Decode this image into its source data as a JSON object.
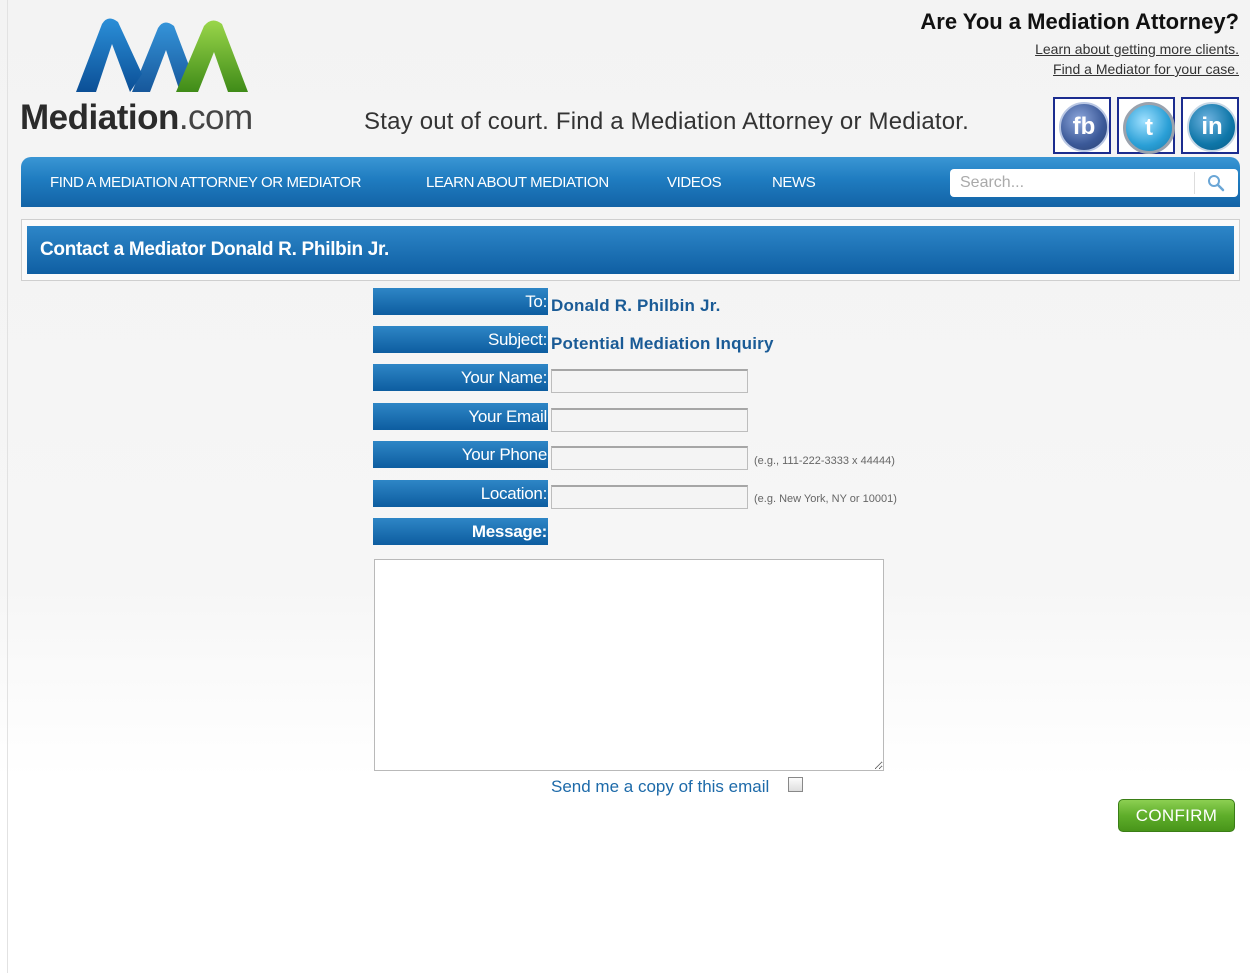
{
  "header": {
    "logo_bold": "Mediation",
    "logo_suffix": ".com",
    "tagline": "Stay out of court. Find a Mediation Attorney or Mediator.",
    "attorney_question": "Are You a Mediation Attorney?",
    "link_more_clients": "Learn about getting more clients.",
    "link_find_mediator": "Find a Mediator for your case.",
    "social": [
      {
        "name": "facebook",
        "glyph": "fb"
      },
      {
        "name": "twitter",
        "glyph": "t"
      },
      {
        "name": "linkedin",
        "glyph": "in"
      }
    ]
  },
  "nav": {
    "items": [
      "FIND A MEDIATION ATTORNEY OR MEDIATOR",
      "LEARN ABOUT MEDIATION",
      "VIDEOS",
      "NEWS"
    ],
    "search_placeholder": "Search..."
  },
  "page_title": "Contact a Mediator Donald R. Philbin Jr.",
  "form": {
    "to_label": "To:",
    "to_value": "Donald R. Philbin Jr.",
    "subject_label": "Subject:",
    "subject_value": "Potential Mediation Inquiry",
    "name_label": "Your Name:",
    "name_value": "",
    "email_label": "Your Email",
    "email_value": "",
    "phone_label": "Your Phone",
    "phone_value": "",
    "phone_hint": "(e.g., 111-222-3333 x 44444)",
    "location_label": "Location:",
    "location_value": "",
    "location_hint": "(e.g. New York, NY or 10001)",
    "message_label": "Message:",
    "message_value": "",
    "copy_label": "Send me a copy of this email",
    "copy_checked": false,
    "confirm_label": "CONFIRM"
  },
  "colors": {
    "brand_blue": "#1363a6",
    "confirm_green": "#5fae2a",
    "link_blue": "#1d6aa9"
  }
}
